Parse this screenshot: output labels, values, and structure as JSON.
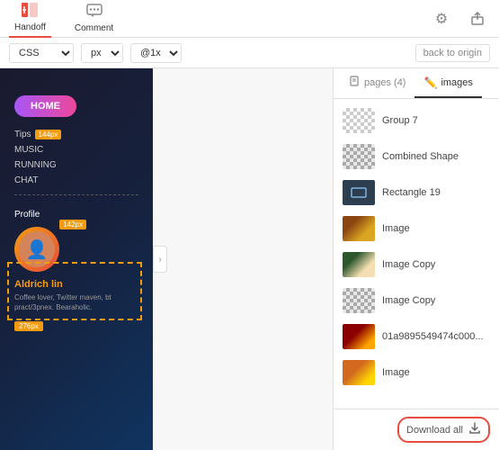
{
  "toolbar": {
    "handoff_label": "Handoff",
    "comment_label": "Comment",
    "settings_label": "⚙",
    "share_label": "⬆"
  },
  "sub_toolbar": {
    "css_label": "CSS",
    "px_label": "px",
    "zoom_label": "@1x",
    "back_label": "back to origin"
  },
  "right_panel": {
    "pages_tab": "pages (4)",
    "images_tab": "images",
    "images": [
      {
        "name": "Group 7",
        "thumb_type": "checkered"
      },
      {
        "name": "Combined Shape",
        "thumb_type": "checkered2"
      },
      {
        "name": "Rectangle 19",
        "thumb_type": "dark"
      },
      {
        "name": "Image",
        "thumb_type": "food1"
      },
      {
        "name": "Image Copy",
        "thumb_type": "sushi"
      },
      {
        "name": "Image Copy",
        "thumb_type": "checkered2"
      },
      {
        "name": "01a9895549474c000...",
        "thumb_type": "restaurant"
      },
      {
        "name": "Image",
        "thumb_type": "bottom-food"
      }
    ],
    "download_all_label": "Download all"
  },
  "canvas": {
    "nav_home": "HOME",
    "nav_tips": "Tips",
    "nav_music": "MUSIC",
    "nav_running": "RUNNING",
    "nav_chat": "CHAT",
    "profile_label": "Profile",
    "profile_name": "Aldrich lin",
    "profile_desc": "Coffee lover, Twitter maven,\nbt pract/3pnex. Bearaholic.",
    "size_144": "144px",
    "size_142": "142px",
    "size_276": "276px"
  }
}
